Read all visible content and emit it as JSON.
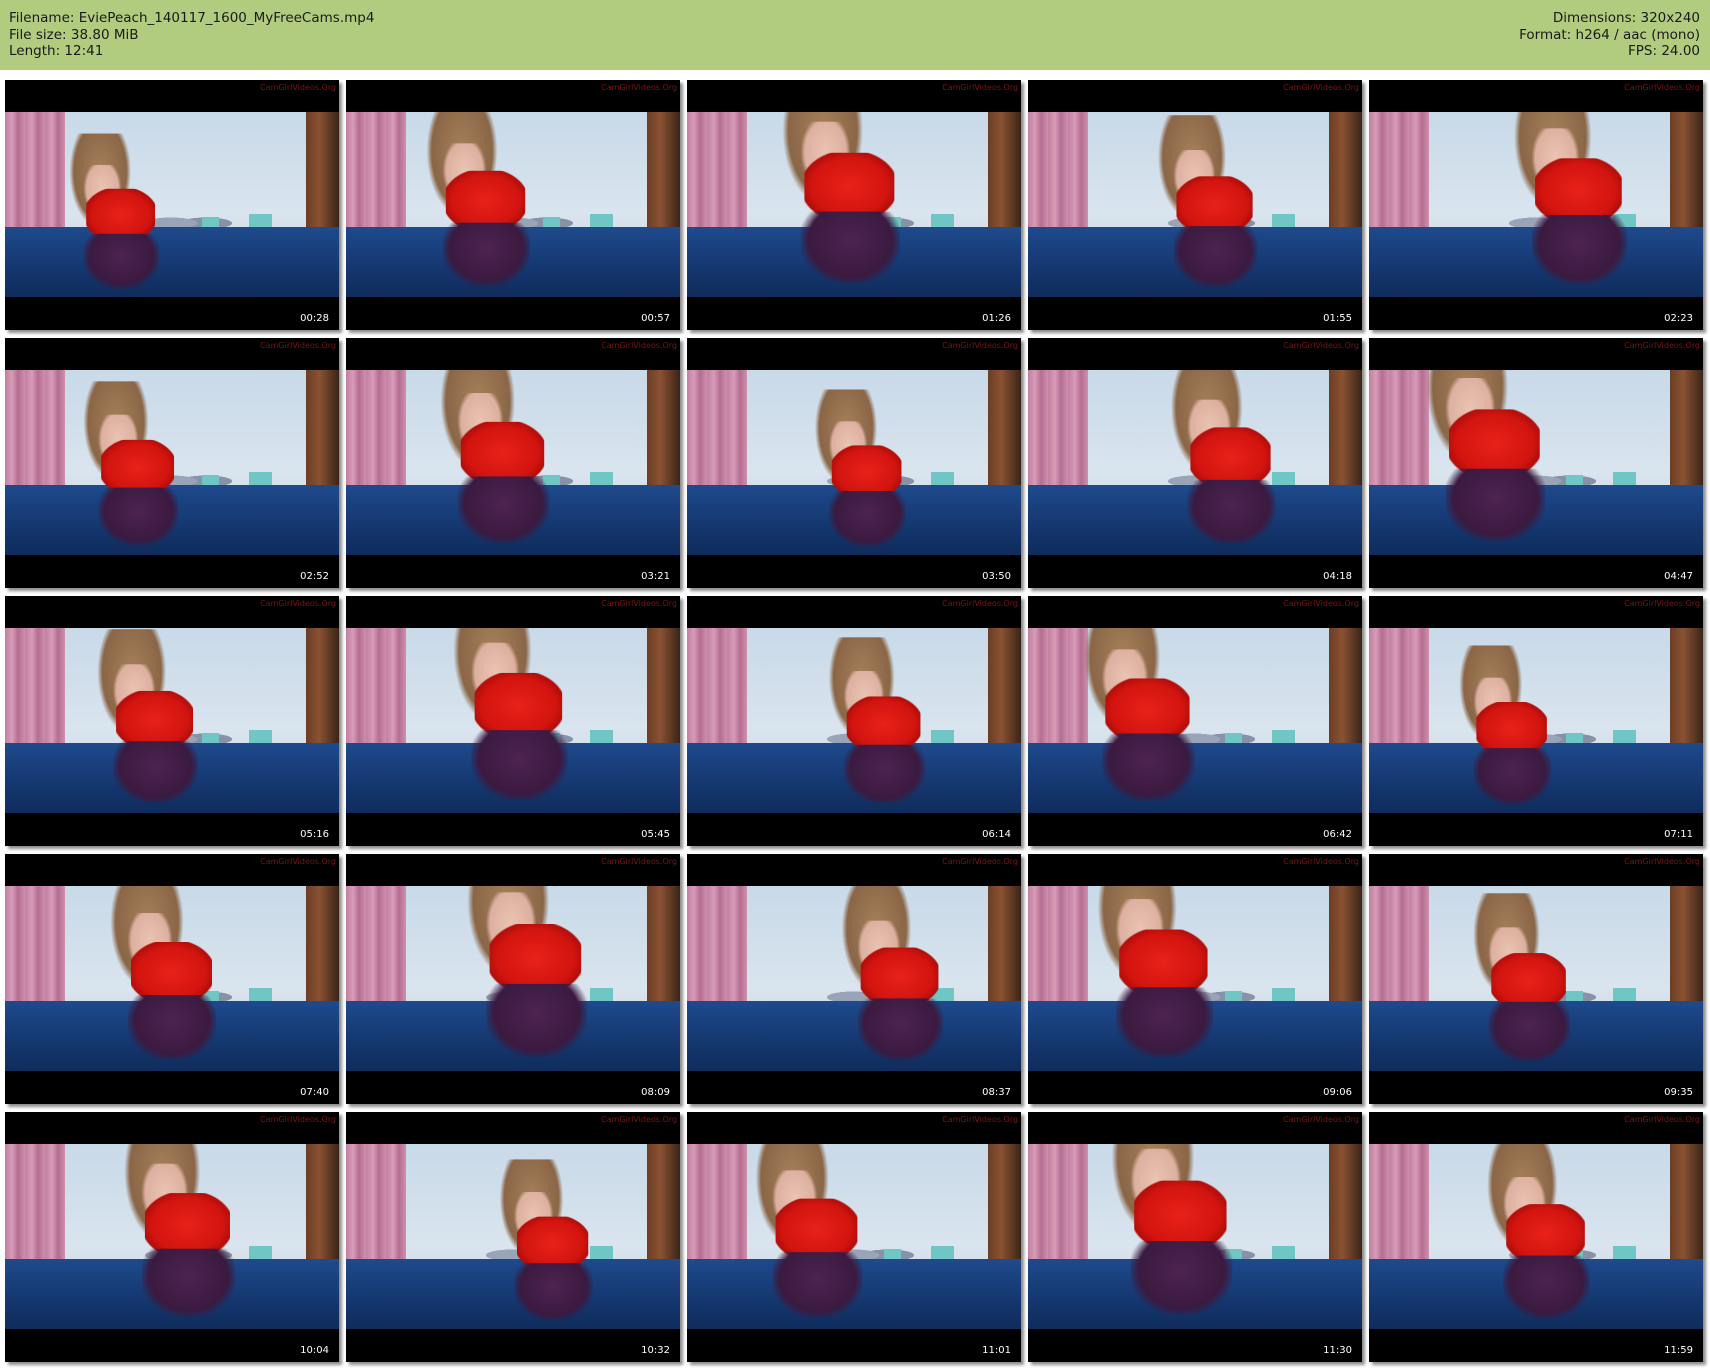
{
  "header": {
    "filename": "Filename: EviePeach_140117_1600_MyFreeCams.mp4",
    "file_size": "File size: 38.80 MiB",
    "length": "Length: 12:41",
    "dimensions": "Dimensions: 320x240",
    "format": "Format: h264 / aac (mono)",
    "fps": "FPS: 24.00",
    "background_color": "#b1cb7f"
  },
  "thumbnails": [
    {
      "timestamp": "00:28"
    },
    {
      "timestamp": "00:57"
    },
    {
      "timestamp": "01:26"
    },
    {
      "timestamp": "01:55"
    },
    {
      "timestamp": "02:23"
    },
    {
      "timestamp": "02:52"
    },
    {
      "timestamp": "03:21"
    },
    {
      "timestamp": "03:50"
    },
    {
      "timestamp": "04:18"
    },
    {
      "timestamp": "04:47"
    },
    {
      "timestamp": "05:16"
    },
    {
      "timestamp": "05:45"
    },
    {
      "timestamp": "06:14"
    },
    {
      "timestamp": "06:42"
    },
    {
      "timestamp": "07:11"
    },
    {
      "timestamp": "07:40"
    },
    {
      "timestamp": "08:09"
    },
    {
      "timestamp": "08:37"
    },
    {
      "timestamp": "09:06"
    },
    {
      "timestamp": "09:35"
    },
    {
      "timestamp": "10:04"
    },
    {
      "timestamp": "10:32"
    },
    {
      "timestamp": "11:01"
    },
    {
      "timestamp": "11:30"
    },
    {
      "timestamp": "11:59"
    }
  ],
  "watermark": "CamGirlVideos.Org"
}
